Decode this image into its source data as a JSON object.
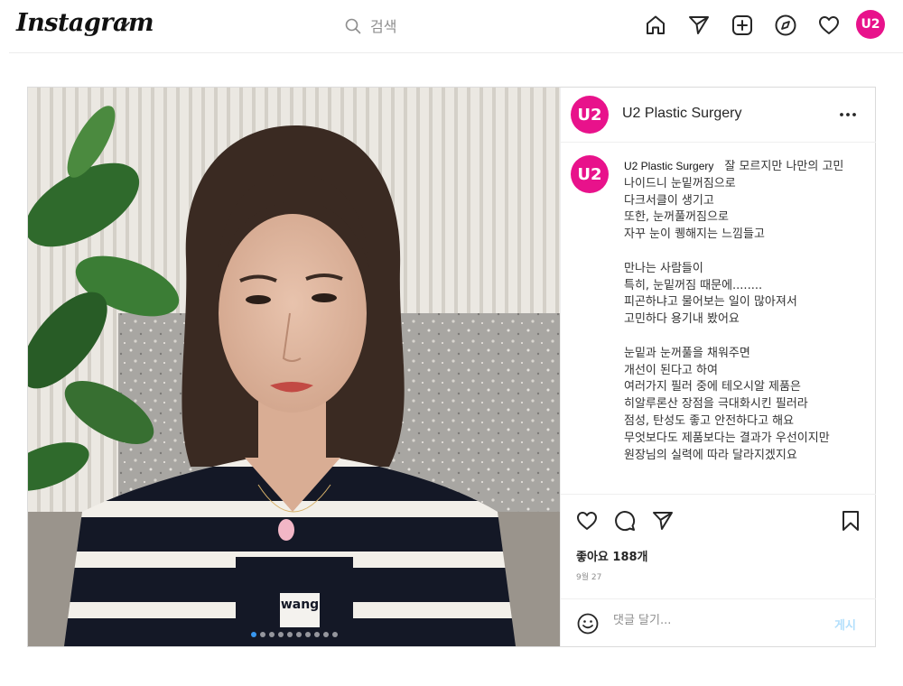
{
  "header": {
    "logo": "Instagram",
    "search_placeholder": "검색",
    "profile_avatar_text": "U2"
  },
  "post": {
    "account": {
      "username": "U2 Plastic Surgery",
      "avatar_text": "U2"
    },
    "image_print_text": "wang",
    "carousel": {
      "count": 10,
      "active_index": 0
    },
    "caption": {
      "username": "U2 Plastic Surgery",
      "text": "잘 모르지만 나만의 고민\n나이드니 눈밑꺼짐으로\n다크서클이 생기고\n또한, 눈꺼풀꺼짐으로\n자꾸 눈이 퀭해지는 느낌들고\n\n만나는 사람들이\n특히, 눈밑꺼짐 때문에........\n피곤하냐고 물어보는 일이 많아져서\n고민하다 용기내 봤어요\n\n눈밑과 눈꺼풀을 채워주면\n개선이 된다고 하여\n여러가지 필러 중에 테오시알 제품은\n히알루론산 장점을 극대화시킨 필러라\n점성, 탄성도 좋고 안전하다고 해요\n무엇보다도 제품보다는 결과가 우선이지만\n원장님의 실력에 따라 달라지겠지요"
    },
    "likes": "좋아요 188개",
    "date": "9월 27",
    "comment": {
      "placeholder": "댓글 달기...",
      "post_label": "게시"
    }
  },
  "colors": {
    "brand": "#e8128b",
    "post_button_disabled": "#b2dffc",
    "carousel_active": "#3897f0"
  },
  "icons": [
    "chevron-down-icon",
    "search-icon",
    "home-icon",
    "send-icon",
    "new-post-icon",
    "explore-icon",
    "heart-icon",
    "more-icon",
    "like-icon",
    "comment-icon",
    "share-icon",
    "save-icon",
    "emoji-icon"
  ]
}
